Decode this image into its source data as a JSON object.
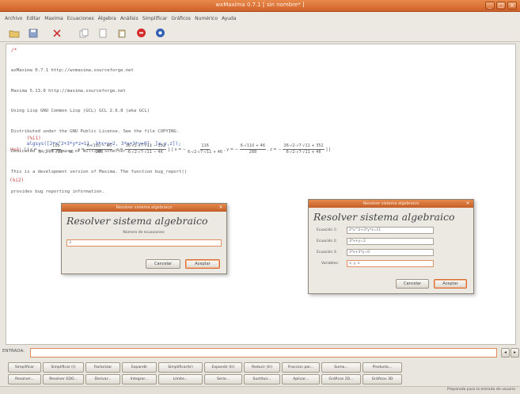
{
  "window": {
    "title": "wxMaxima 0.7.1 [ sin nombre* ]",
    "controls": [
      "_",
      "□",
      "×"
    ]
  },
  "menubar": [
    "Archivo",
    "Editar",
    "Maxima",
    "Ecuaciones",
    "Álgebra",
    "Análisis",
    "Simplificar",
    "Gráficos",
    "Numérico",
    "Ayuda"
  ],
  "toolbar": {
    "icons": [
      "open-icon",
      "save-icon",
      "cut-icon",
      "copy-icon",
      "clear-icon",
      "paste-icon",
      "stop-icon",
      "help-icon"
    ]
  },
  "worksheet": {
    "prompt0": "/*",
    "banner": [
      "wxMaxima 0.7.1 http://wxmaxima.sourceforge.net",
      "Maxima 5.13.0 http://maxima.sourceforge.net",
      "Using Lisp GNU Common Lisp (GCL) GCL 2.6.8 (aka GCL)",
      "Distributed under the GNU Public License. See the file COPYING.",
      "Dedicated to the memory of William Schelter.",
      "This is a development version of Maxima. The function bug_report()",
      "provides bug reporting information."
    ],
    "input1_label": "(%i1)",
    "input1_code": "algsys([2*x^2+3*y*z=11, 3*x+y=2, 3*x+3*y=0], [x,y,z]);",
    "output1_label": "(%o1)",
    "solution1": {
      "x_num": "116",
      "x_den": "6·√2·√7·√11 − 46",
      "y_num": "6·√110 − 46",
      "y_den": "288",
      "z_num": "36·√2·√7·√11 − 352",
      "z_den": "6·√2·√7·√11 − 46"
    },
    "solution2": {
      "x_num": "116",
      "x_den": "6·√2·√7·√11 + 46",
      "y_num": "6·√110 + 46",
      "y_den": "288",
      "z_num": "36·√2·√7·√11 + 352",
      "z_den": "6·√2·√7·√11 + 46"
    },
    "input2_label": "(%i2)"
  },
  "dialog1": {
    "title": "Resolver sistema algebraico",
    "heading": "Resolver sistema algebraico",
    "label": "Número de ecuaciones:",
    "value": "3",
    "cancel": "Cancelar",
    "accept": "Aceptar"
  },
  "dialog2": {
    "title": "Resolver sistema algebraico",
    "heading": "Resolver sistema algebraico",
    "rows": [
      {
        "label": "Ecuación 1:",
        "value": "2*x^2+3*y*z=11"
      },
      {
        "label": "Ecuación 2:",
        "value": "3*x+y=2"
      },
      {
        "label": "Ecuación 3:",
        "value": "3*x+3*y=0"
      },
      {
        "label": "Variables:",
        "value": "x, y, z"
      }
    ],
    "cancel": "Cancelar",
    "accept": "Aceptar"
  },
  "inputbar": {
    "label": "ENTRADA:",
    "value": "",
    "btn1": "◂",
    "btn2": "▸"
  },
  "panel": {
    "row1": [
      "Simplificar",
      "Simplificar (r)",
      "Factorizar",
      "Expandir",
      "Simplificar(tr)",
      "Expandir (tr)",
      "Reducir (tr)",
      "Fraccion par...",
      "Suma...",
      "Producto..."
    ],
    "row2": [
      "Resolver...",
      "Resolver EDO...",
      "Derivar...",
      "Integrar...",
      "Límite...",
      "Serie...",
      "Sustituir...",
      "Aplicar...",
      "Gráficos 2D...",
      "Gráficos 3D"
    ]
  },
  "status": "Preparado para la entrada de usuario"
}
